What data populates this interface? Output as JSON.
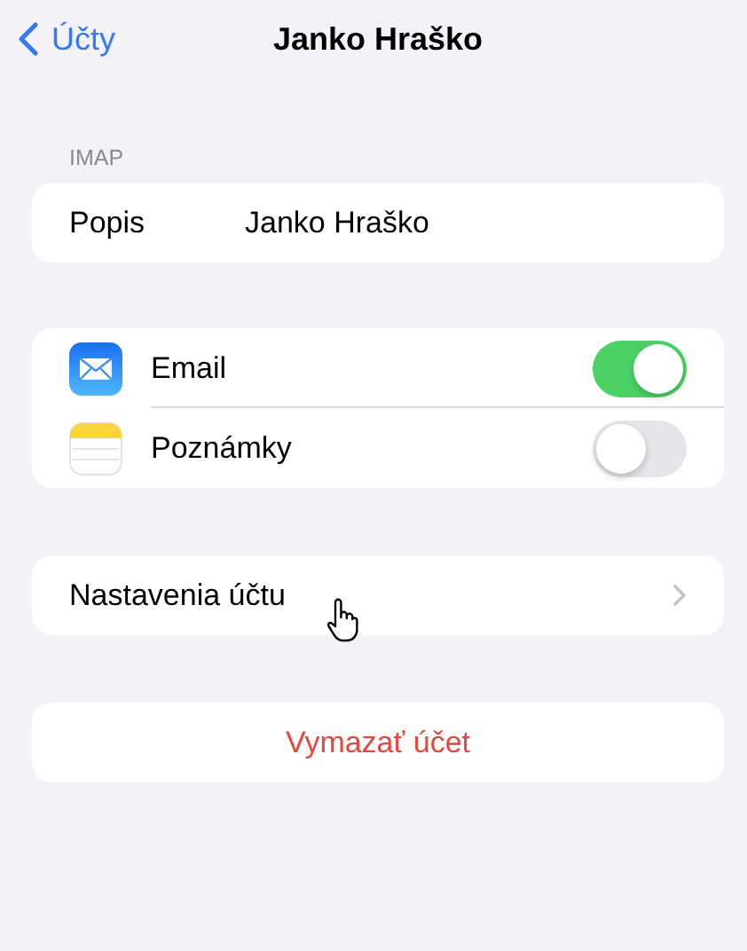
{
  "nav": {
    "back": "Účty",
    "title": "Janko Hraško"
  },
  "section_header": "IMAP",
  "description": {
    "label": "Popis",
    "value": "Janko Hraško"
  },
  "toggles": [
    {
      "label": "Email",
      "on": true
    },
    {
      "label": "Poznámky",
      "on": false
    }
  ],
  "account_settings": "Nastavenia účtu",
  "delete": "Vymazať účet"
}
